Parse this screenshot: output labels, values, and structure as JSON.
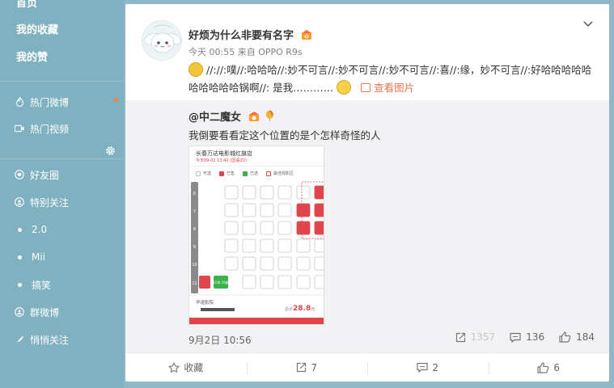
{
  "sidebar": {
    "top_partial": "首页",
    "favorites": "我的收藏",
    "likes": "我的赞",
    "hot_weibo": "热门微博",
    "hot_video": "热门视频",
    "friends_circle": "好友圈",
    "special_follow": "特别关注",
    "groups": [
      "2.0",
      "Mii",
      "搞笑"
    ],
    "group_weibo": "群微博",
    "secret_follow": "悄悄关注"
  },
  "post": {
    "author": "好烦为什么非要有名字",
    "time": "今天 00:55",
    "source_prefix": "来自",
    "source": "OPPO R9s",
    "text_1": "//://:噗//:哈哈哈//:妙不可言//:妙不可言//:妙不可言//:喜//:缘，妙不可言//:好哈哈哈哈哈哈哈哈哈哈锅啊//: 是我…………",
    "view_pics": "查看图片"
  },
  "repost": {
    "author": "@中二魔女",
    "text": "我倒要看看定这个位置的是个怎样奇怪的人",
    "date": "9月2日 10:56",
    "forward_count": "1357",
    "comment_count": "136",
    "like_count": "184",
    "image": {
      "cinema": "长春万达电影城红旗店",
      "showtime": "今天09-02 13:40 (国语2D)",
      "legend": [
        "可选",
        "已售",
        "已选",
        "最佳观影区"
      ],
      "rows": [
        "6",
        "7",
        "8",
        "9",
        "10",
        "11"
      ],
      "seat_label": "11排 16座",
      "price_prefix": "总价",
      "price": "28.8",
      "price_suffix": "元",
      "footer_text": "华谊影院"
    }
  },
  "actions": {
    "favorite": "收藏",
    "forward": "7",
    "comment": "2",
    "like": "6"
  },
  "colors": {
    "sidebar_bg": "#7fb1c0",
    "accent_orange": "#eb7350",
    "sold_red": "#e0454c",
    "selected_green": "#3eb24a"
  }
}
